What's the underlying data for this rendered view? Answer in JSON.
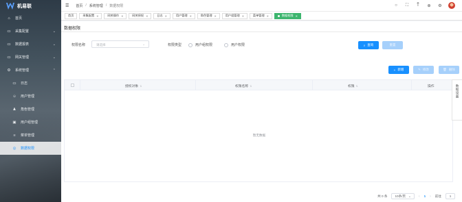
{
  "brand": {
    "name": "机易联"
  },
  "sidebar": {
    "items": [
      {
        "label": "首页",
        "icon": "home-icon"
      },
      {
        "label": "采集配置",
        "icon": "folder-icon",
        "expandable": true
      },
      {
        "label": "数据报表",
        "icon": "folder-icon",
        "expandable": true
      },
      {
        "label": "网关管理",
        "icon": "folder-icon",
        "expandable": true
      },
      {
        "label": "系统管理",
        "icon": "gear-icon",
        "expandable": true,
        "expanded": true
      }
    ],
    "subitems": [
      {
        "label": "日志",
        "icon": "monitor-icon"
      },
      {
        "label": "用户管理",
        "icon": "user-icon"
      },
      {
        "label": "角色管理",
        "icon": "role-icon"
      },
      {
        "label": "用户组管理",
        "icon": "group-icon"
      },
      {
        "label": "菜单管理",
        "icon": "menu-icon"
      },
      {
        "label": "数据权限",
        "icon": "lock-icon",
        "active": true
      }
    ]
  },
  "header": {
    "breadcrumb": [
      "首页",
      "系统管理",
      "数据权限"
    ]
  },
  "tabs": [
    {
      "label": "首页",
      "closable": false
    },
    {
      "label": "采集配置",
      "closable": true
    },
    {
      "label": "网关操作",
      "closable": true
    },
    {
      "label": "网关授权",
      "closable": true
    },
    {
      "label": "日志",
      "closable": true
    },
    {
      "label": "用户管理",
      "closable": true
    },
    {
      "label": "角色管理",
      "closable": true
    },
    {
      "label": "用户组管理",
      "closable": true
    },
    {
      "label": "菜单管理",
      "closable": true
    },
    {
      "label": "数据权限",
      "closable": true,
      "active": true
    }
  ],
  "page": {
    "title": "数据权限",
    "filters": {
      "name_label": "权限名称",
      "name_placeholder": "请选择",
      "type_label": "权限类型",
      "type_options": [
        "用户组权限",
        "用户权限"
      ]
    },
    "buttons": {
      "query": "查询",
      "reset": "重置",
      "add": "新增",
      "edit": "修改",
      "delete": "删除"
    },
    "table": {
      "columns": [
        "授权对象",
        "权限名称",
        "权限",
        "操作"
      ],
      "empty_text": "暂无数据"
    },
    "side_tab": "数据设置",
    "pagination": {
      "total": "共 0 条",
      "page_size": "10条/页",
      "current_page": "1",
      "goto_label": "前往",
      "goto_value": "1"
    }
  },
  "colors": {
    "primary": "#1890ff",
    "active_tab": "#3db56e"
  }
}
